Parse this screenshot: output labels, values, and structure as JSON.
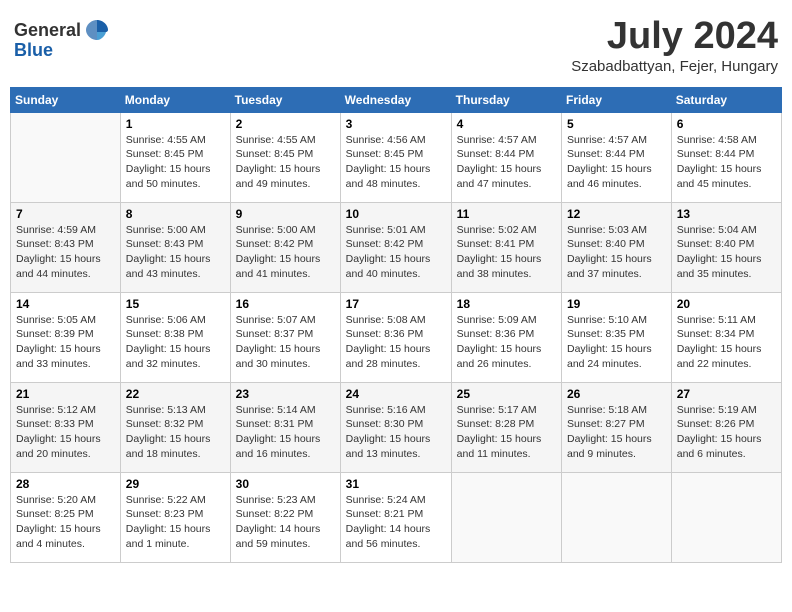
{
  "header": {
    "logo_general": "General",
    "logo_blue": "Blue",
    "month_title": "July 2024",
    "location": "Szabadbattyan, Fejer, Hungary"
  },
  "weekdays": [
    "Sunday",
    "Monday",
    "Tuesday",
    "Wednesday",
    "Thursday",
    "Friday",
    "Saturday"
  ],
  "weeks": [
    [
      {
        "day": "",
        "sunrise": "",
        "sunset": "",
        "daylight": ""
      },
      {
        "day": "1",
        "sunrise": "Sunrise: 4:55 AM",
        "sunset": "Sunset: 8:45 PM",
        "daylight": "Daylight: 15 hours and 50 minutes."
      },
      {
        "day": "2",
        "sunrise": "Sunrise: 4:55 AM",
        "sunset": "Sunset: 8:45 PM",
        "daylight": "Daylight: 15 hours and 49 minutes."
      },
      {
        "day": "3",
        "sunrise": "Sunrise: 4:56 AM",
        "sunset": "Sunset: 8:45 PM",
        "daylight": "Daylight: 15 hours and 48 minutes."
      },
      {
        "day": "4",
        "sunrise": "Sunrise: 4:57 AM",
        "sunset": "Sunset: 8:44 PM",
        "daylight": "Daylight: 15 hours and 47 minutes."
      },
      {
        "day": "5",
        "sunrise": "Sunrise: 4:57 AM",
        "sunset": "Sunset: 8:44 PM",
        "daylight": "Daylight: 15 hours and 46 minutes."
      },
      {
        "day": "6",
        "sunrise": "Sunrise: 4:58 AM",
        "sunset": "Sunset: 8:44 PM",
        "daylight": "Daylight: 15 hours and 45 minutes."
      }
    ],
    [
      {
        "day": "7",
        "sunrise": "Sunrise: 4:59 AM",
        "sunset": "Sunset: 8:43 PM",
        "daylight": "Daylight: 15 hours and 44 minutes."
      },
      {
        "day": "8",
        "sunrise": "Sunrise: 5:00 AM",
        "sunset": "Sunset: 8:43 PM",
        "daylight": "Daylight: 15 hours and 43 minutes."
      },
      {
        "day": "9",
        "sunrise": "Sunrise: 5:00 AM",
        "sunset": "Sunset: 8:42 PM",
        "daylight": "Daylight: 15 hours and 41 minutes."
      },
      {
        "day": "10",
        "sunrise": "Sunrise: 5:01 AM",
        "sunset": "Sunset: 8:42 PM",
        "daylight": "Daylight: 15 hours and 40 minutes."
      },
      {
        "day": "11",
        "sunrise": "Sunrise: 5:02 AM",
        "sunset": "Sunset: 8:41 PM",
        "daylight": "Daylight: 15 hours and 38 minutes."
      },
      {
        "day": "12",
        "sunrise": "Sunrise: 5:03 AM",
        "sunset": "Sunset: 8:40 PM",
        "daylight": "Daylight: 15 hours and 37 minutes."
      },
      {
        "day": "13",
        "sunrise": "Sunrise: 5:04 AM",
        "sunset": "Sunset: 8:40 PM",
        "daylight": "Daylight: 15 hours and 35 minutes."
      }
    ],
    [
      {
        "day": "14",
        "sunrise": "Sunrise: 5:05 AM",
        "sunset": "Sunset: 8:39 PM",
        "daylight": "Daylight: 15 hours and 33 minutes."
      },
      {
        "day": "15",
        "sunrise": "Sunrise: 5:06 AM",
        "sunset": "Sunset: 8:38 PM",
        "daylight": "Daylight: 15 hours and 32 minutes."
      },
      {
        "day": "16",
        "sunrise": "Sunrise: 5:07 AM",
        "sunset": "Sunset: 8:37 PM",
        "daylight": "Daylight: 15 hours and 30 minutes."
      },
      {
        "day": "17",
        "sunrise": "Sunrise: 5:08 AM",
        "sunset": "Sunset: 8:36 PM",
        "daylight": "Daylight: 15 hours and 28 minutes."
      },
      {
        "day": "18",
        "sunrise": "Sunrise: 5:09 AM",
        "sunset": "Sunset: 8:36 PM",
        "daylight": "Daylight: 15 hours and 26 minutes."
      },
      {
        "day": "19",
        "sunrise": "Sunrise: 5:10 AM",
        "sunset": "Sunset: 8:35 PM",
        "daylight": "Daylight: 15 hours and 24 minutes."
      },
      {
        "day": "20",
        "sunrise": "Sunrise: 5:11 AM",
        "sunset": "Sunset: 8:34 PM",
        "daylight": "Daylight: 15 hours and 22 minutes."
      }
    ],
    [
      {
        "day": "21",
        "sunrise": "Sunrise: 5:12 AM",
        "sunset": "Sunset: 8:33 PM",
        "daylight": "Daylight: 15 hours and 20 minutes."
      },
      {
        "day": "22",
        "sunrise": "Sunrise: 5:13 AM",
        "sunset": "Sunset: 8:32 PM",
        "daylight": "Daylight: 15 hours and 18 minutes."
      },
      {
        "day": "23",
        "sunrise": "Sunrise: 5:14 AM",
        "sunset": "Sunset: 8:31 PM",
        "daylight": "Daylight: 15 hours and 16 minutes."
      },
      {
        "day": "24",
        "sunrise": "Sunrise: 5:16 AM",
        "sunset": "Sunset: 8:30 PM",
        "daylight": "Daylight: 15 hours and 13 minutes."
      },
      {
        "day": "25",
        "sunrise": "Sunrise: 5:17 AM",
        "sunset": "Sunset: 8:28 PM",
        "daylight": "Daylight: 15 hours and 11 minutes."
      },
      {
        "day": "26",
        "sunrise": "Sunrise: 5:18 AM",
        "sunset": "Sunset: 8:27 PM",
        "daylight": "Daylight: 15 hours and 9 minutes."
      },
      {
        "day": "27",
        "sunrise": "Sunrise: 5:19 AM",
        "sunset": "Sunset: 8:26 PM",
        "daylight": "Daylight: 15 hours and 6 minutes."
      }
    ],
    [
      {
        "day": "28",
        "sunrise": "Sunrise: 5:20 AM",
        "sunset": "Sunset: 8:25 PM",
        "daylight": "Daylight: 15 hours and 4 minutes."
      },
      {
        "day": "29",
        "sunrise": "Sunrise: 5:22 AM",
        "sunset": "Sunset: 8:23 PM",
        "daylight": "Daylight: 15 hours and 1 minute."
      },
      {
        "day": "30",
        "sunrise": "Sunrise: 5:23 AM",
        "sunset": "Sunset: 8:22 PM",
        "daylight": "Daylight: 14 hours and 59 minutes."
      },
      {
        "day": "31",
        "sunrise": "Sunrise: 5:24 AM",
        "sunset": "Sunset: 8:21 PM",
        "daylight": "Daylight: 14 hours and 56 minutes."
      },
      {
        "day": "",
        "sunrise": "",
        "sunset": "",
        "daylight": ""
      },
      {
        "day": "",
        "sunrise": "",
        "sunset": "",
        "daylight": ""
      },
      {
        "day": "",
        "sunrise": "",
        "sunset": "",
        "daylight": ""
      }
    ]
  ]
}
